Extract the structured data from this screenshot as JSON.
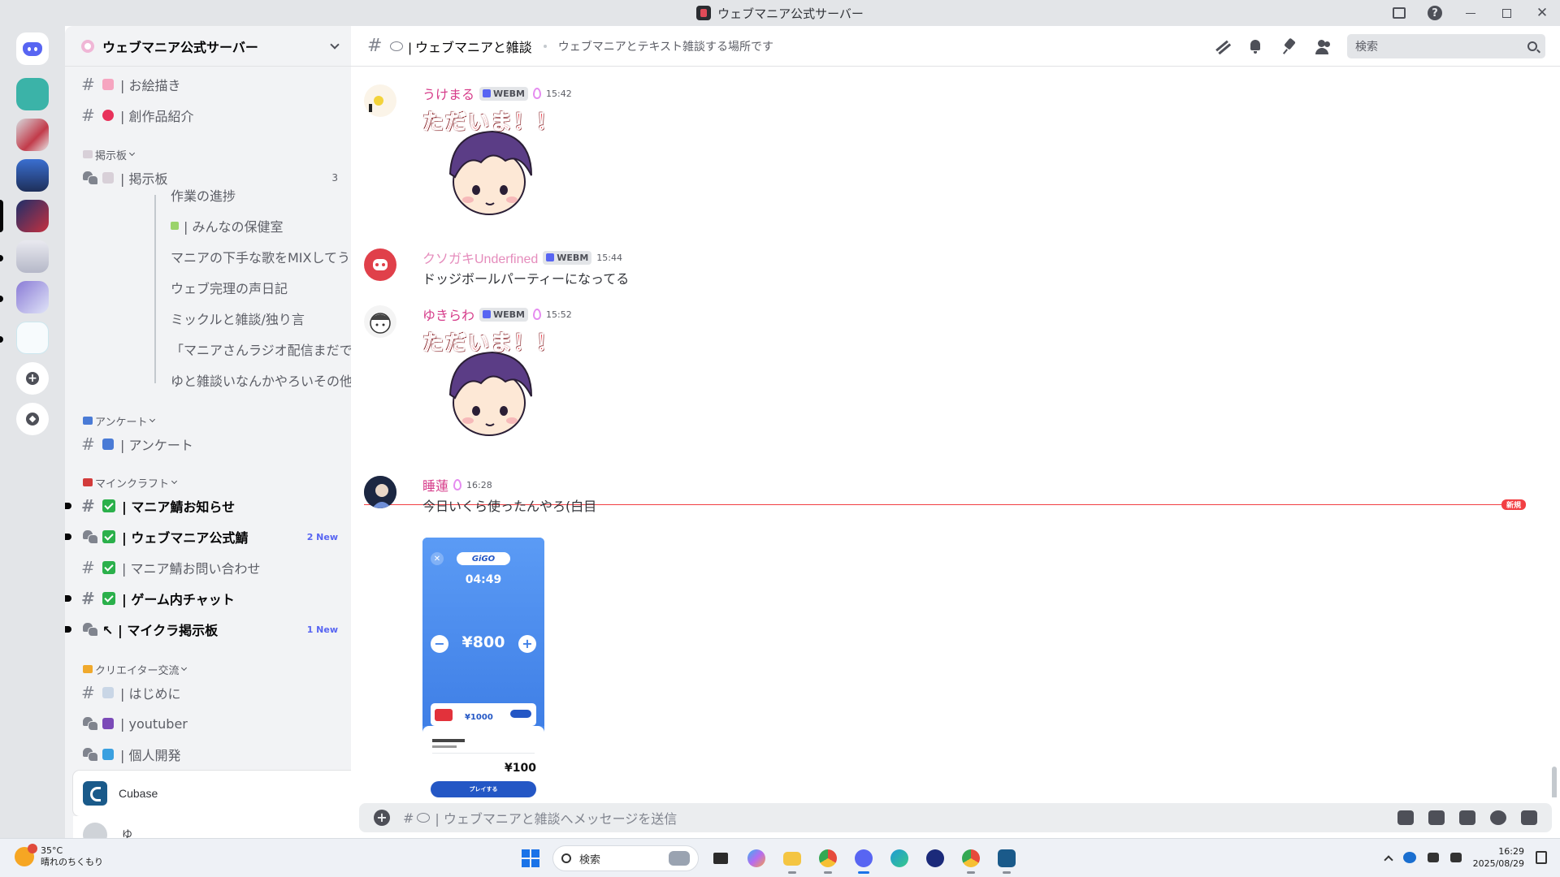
{
  "window": {
    "title": "ウェブマニア公式サーバー"
  },
  "server": {
    "name": "ウェブマニア公式サーバー"
  },
  "sidebar": {
    "channels_top": [
      {
        "type": "text",
        "label": "| お絵描き",
        "emoji_color": "#f6a5c0"
      },
      {
        "type": "text",
        "label": "| 創作品紹介",
        "emoji_color": "#e8325b"
      }
    ],
    "category_board": "掲示板",
    "board_channel": {
      "label": "| 掲示板",
      "count": "3"
    },
    "threads": [
      "作業の進捗",
      "| みんなの保健室",
      "マニアの下手な歌をMIXしてうまくす...",
      "ウェブ完理の声日記",
      "ミックルと雑談/独り言",
      "「マニアさんラジオ配信まだですか...",
      "ゆと雑談いなんかやろいその他"
    ],
    "category_survey": "アンケート",
    "survey_channel": "| アンケート",
    "category_minecraft": "マインクラフト",
    "minecraft_channels": [
      {
        "type": "text",
        "label": "| マニア鯖お知らせ",
        "bold": true,
        "badge": ""
      },
      {
        "type": "forum",
        "label": "| ウェブマニア公式鯖",
        "bold": true,
        "badge": "2 New"
      },
      {
        "type": "text",
        "label": "| マニア鯖お問い合わせ",
        "bold": false,
        "badge": ""
      },
      {
        "type": "text",
        "label": "| ゲーム内チャット",
        "bold": true,
        "badge": ""
      },
      {
        "type": "forum",
        "label": "↖ | マイクラ掲示板",
        "bold": true,
        "badge": "1 New"
      }
    ],
    "category_creator": "クリエイター交流",
    "creator_channels": [
      {
        "type": "text",
        "label": "| はじめに"
      },
      {
        "type": "forum",
        "label": "| youtuber"
      },
      {
        "type": "text",
        "label": "| 個人開発"
      }
    ],
    "activity_name": "Cubase",
    "user_name": "ゆ"
  },
  "chat": {
    "channel_name": "| ウェブマニアと雑談",
    "topic": "ウェブマニアとテキスト雑談する場所です",
    "search_placeholder": "検索",
    "new_label": "新規",
    "composer_placeholder": "| ウェブマニアと雑談へメッセージを送信",
    "messages": [
      {
        "user": "うけまる",
        "tag": "WEBM",
        "boost": true,
        "time": "15:42",
        "sticker": "ただいま！！"
      },
      {
        "user": "クソガキUnderfined",
        "tag": "WEBM",
        "boost": false,
        "time": "15:44",
        "text": "ドッジボールパーティーになってる"
      },
      {
        "user": "ゆきらわ",
        "tag": "WEBM",
        "boost": true,
        "time": "15:52",
        "sticker": "ただいま！！"
      },
      {
        "user": "睡蓮",
        "tag": "",
        "boost": true,
        "time": "16:28",
        "text": "今日いくら使ったんやろ(白目"
      }
    ],
    "phone": {
      "logo": "GiGO",
      "timer": "04:49",
      "amount": "¥800",
      "card_price": "¥1000",
      "pay_amount": "¥100",
      "play": "プレイする"
    }
  },
  "taskbar": {
    "temp": "35°C",
    "weather": "晴れのちくもり",
    "search": "検索",
    "time": "16:29",
    "date": "2025/08/29",
    "apps": [
      {
        "name": "task-view",
        "color": "#2b2b2b"
      },
      {
        "name": "copilot",
        "color": "#b66bf0"
      },
      {
        "name": "file-explorer",
        "color": "#f4c542"
      },
      {
        "name": "chrome",
        "color": "#e64a3c"
      },
      {
        "name": "discord",
        "color": "#5865f2"
      },
      {
        "name": "edge",
        "color": "#1f9ad6"
      },
      {
        "name": "steinberg",
        "color": "#1b2a7a"
      },
      {
        "name": "chrome-profile",
        "color": "#3ea35a"
      },
      {
        "name": "cubase",
        "color": "#1a5a8a"
      }
    ]
  }
}
